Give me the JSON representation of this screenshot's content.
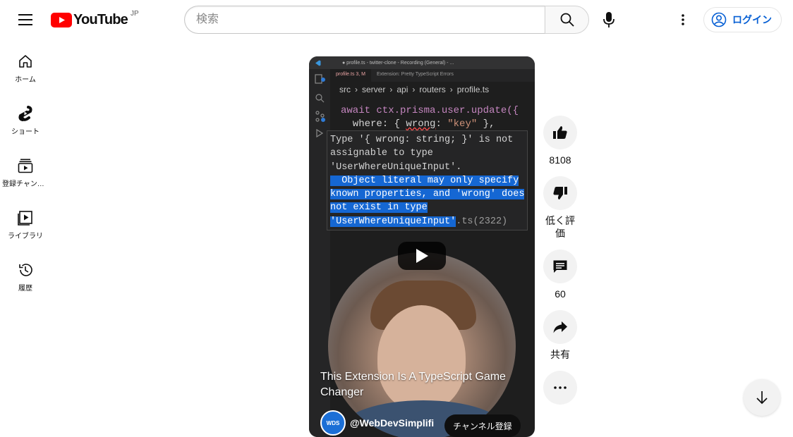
{
  "header": {
    "logo_text": "YouTube",
    "region": "JP",
    "search_placeholder": "検索",
    "signin_label": "ログイン"
  },
  "guide": {
    "items": [
      {
        "label": "ホーム",
        "icon": "home-icon"
      },
      {
        "label": "ショート",
        "icon": "shorts-icon"
      },
      {
        "label": "登録チャンネル",
        "icon": "subscriptions-icon"
      },
      {
        "label": "ライブラリ",
        "icon": "library-icon"
      },
      {
        "label": "履歴",
        "icon": "history-icon"
      }
    ]
  },
  "short": {
    "title": "This Extension Is A TypeScript Game Changer",
    "channel": "@WebDevSimplifi",
    "channel_avatar_text": "WDS",
    "subscribe_label": "チャンネル登録",
    "editor": {
      "window_title": "● profile.ts - twitter-clone - Recording (General) - ...",
      "tab_active": "profile.ts 3, M",
      "tab_other": "Extension: Pretty TypeScript Errors",
      "breadcrumbs": [
        "src",
        "server",
        "api",
        "routers",
        "profile.ts"
      ],
      "code_line1": "await ctx.prisma.user.update({",
      "code_line2_a": "  where: { ",
      "code_line2_err": "wrong",
      "code_line2_b": ": ",
      "code_line2_str": "\"key\"",
      "code_line2_c": " },",
      "tooltip_l1": "Type '{ wrong: string; }' is not",
      "tooltip_l2": "assignable to type",
      "tooltip_l3": "'UserWhereUniqueInput'.",
      "tooltip_l4": "  Object literal may only specify",
      "tooltip_l5": "known properties, and 'wrong' does",
      "tooltip_l6": "not exist in type",
      "tooltip_l7a": "'UserWhereUniqueInput'",
      "tooltip_l7b": ".ts(2322)"
    }
  },
  "actions": {
    "like_count": "8108",
    "dislike_label": "低く評価",
    "comment_count": "60",
    "share_label": "共有"
  },
  "colors": {
    "brand_red": "#ff0000",
    "link_blue": "#065fd4",
    "error_highlight": "#1567d3"
  }
}
